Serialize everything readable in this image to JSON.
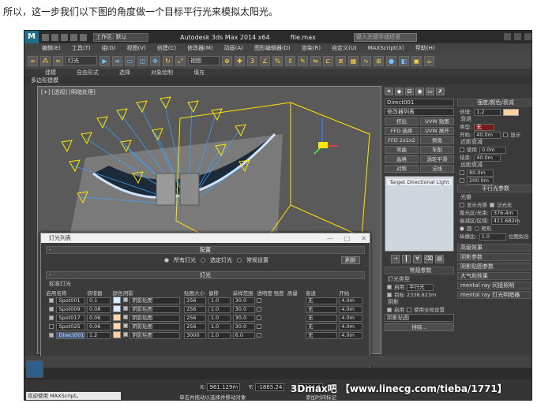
{
  "caption": "所以，这一步我们以下图的角度做一个目标平行光来模拟太阳光。",
  "titlebar": {
    "workspace": "工作区: 默认",
    "app_title": "Autodesk 3ds Max  2014 x64",
    "file_title": "file.max",
    "search_placeholder": "键入关键字或短语"
  },
  "menu": [
    "编辑(E)",
    "工具(T)",
    "组(G)",
    "视图(V)",
    "创建(C)",
    "修改器(M)",
    "动画(A)",
    "图形编辑器(D)",
    "渲染(R)",
    "自定义(U)",
    "MAXScript(X)",
    "帮助(H)"
  ],
  "toolbar": {
    "selection_filter": "灯光",
    "ref_coord": "视图"
  },
  "ribbon": {
    "tabs": [
      "建模",
      "自由形式",
      "选择",
      "对象绘制",
      "填充"
    ],
    "sub_label": "多边形建模"
  },
  "viewport": {
    "label": "[+] [透视] [明暗处理]"
  },
  "command_panel": {
    "object_name": "Direct001",
    "modifier_list": "修改器列表",
    "buttons": [
      [
        "挤出",
        "UVW 贴图"
      ],
      [
        "FFD 选择",
        "UVW 展开"
      ],
      [
        "FFD 2x2x2",
        "倒角"
      ],
      [
        "弯曲",
        "车削"
      ],
      [
        "晶格",
        "涡轮平滑"
      ],
      [
        "对称",
        "法线"
      ]
    ],
    "stack_item": "Target Directional Light",
    "intensity_header": "强度/颜色/衰减",
    "multiplier_label": "倍增:",
    "multiplier": "1.2",
    "decay_label": "衰退",
    "decay_type_label": "类型:",
    "decay_type": "无",
    "start_label": "开始:",
    "start_value": "40.0m",
    "show_label": "显示",
    "near_atten_label": "近距衰减",
    "use_label": "使用",
    "near_start": "0.0m",
    "near_end_label": "结束:",
    "near_end": "40.0m",
    "far_atten_label": "远距衰减",
    "far_start": "80.0m",
    "far_end": "200.0m",
    "directional_header": "平行光参数",
    "spotlight_label": "光锥",
    "overshoot_label": "显示光锥",
    "overshoot2_label": "泛光化",
    "hotspot_label": "聚光区/光束:",
    "hotspot_value": "376.4m",
    "falloff_label": "衰减区/区域:",
    "falloff_value": "411.682m",
    "circle_label": "圆",
    "rect_label": "矩形",
    "aspect_label": "纵横比:",
    "aspect_value": "1.0",
    "bitmap_fit": "位图拟合",
    "general_header": "常规参数",
    "light_type_label": "灯光类型",
    "on_label": "启用",
    "light_type": "平行光",
    "target_label": "目标",
    "target_distance": "2338.823m",
    "shadows_label": "阴影",
    "shadow_on_label": "启用",
    "global_label": "使用全局设置",
    "shadow_type": "阴影贴图",
    "exclude_btn": "排除...",
    "rollouts": [
      "高级效果",
      "阴影参数",
      "阴影贴图参数",
      "大气和效果",
      "mental ray 间接照明",
      "mental ray 灯光明暗器"
    ]
  },
  "dialog": {
    "title": "灯光列表",
    "config_header": "配置",
    "opt_all": "所有灯光",
    "opt_sel": "选定灯光",
    "opt_general": "常规设置",
    "refresh": "刷新",
    "lights_header": "灯光",
    "group_label": "标准灯光",
    "columns": [
      "启用",
      "名称",
      "倍增器",
      "颜色",
      "阴影",
      "贴图大小",
      "偏移",
      "采样范围",
      "透明度",
      "强度",
      "质量",
      "衰退",
      "开始"
    ],
    "rows": [
      {
        "name": "Spot001",
        "mult": "0.1",
        "color": "#d9ecff",
        "shadow": "阴影贴图",
        "map": "256",
        "bias": "1.0",
        "sample": "30.0",
        "decay": "无",
        "start": "4.0m",
        "enabled": true,
        "selected": false
      },
      {
        "name": "Spot009",
        "mult": "0.08",
        "color": "#d9ecff",
        "shadow": "阴影贴图",
        "map": "256",
        "bias": "1.0",
        "sample": "30.0",
        "decay": "无",
        "start": "4.0m",
        "enabled": true,
        "selected": false
      },
      {
        "name": "Spot017",
        "mult": "0.06",
        "color": "#ffd8a8",
        "shadow": "阴影贴图",
        "map": "256",
        "bias": "1.0",
        "sample": "30.0",
        "decay": "无",
        "start": "4.0m",
        "enabled": true,
        "selected": false
      },
      {
        "name": "Spot025",
        "mult": "0.06",
        "color": "#ffd8a8",
        "shadow": "阴影贴图",
        "map": "256",
        "bias": "1.0",
        "sample": "30.0",
        "decay": "无",
        "start": "4.0m",
        "enabled": false,
        "selected": false
      },
      {
        "name": "Direct001",
        "mult": "1.2",
        "color": "#ffd0a0",
        "shadow": "阴影贴图",
        "map": "3000",
        "bias": "1.0",
        "sample": "6.0",
        "decay": "无",
        "start": "4.0m",
        "enabled": true,
        "selected": true
      }
    ]
  },
  "status": {
    "maxscript": "欢迎使用 MAXScript。",
    "hint": "单击并拖动以选择并移动对象",
    "x_label": "X:",
    "x": "961.129m",
    "y_label": "Y:",
    "y": "-1865.24",
    "z_label": "Z:",
    "z": "1184.8",
    "add_time_tag": "添加时间标记"
  },
  "watermark": "3Dmax吧 【www.linecg.com/tieba/1771】"
}
